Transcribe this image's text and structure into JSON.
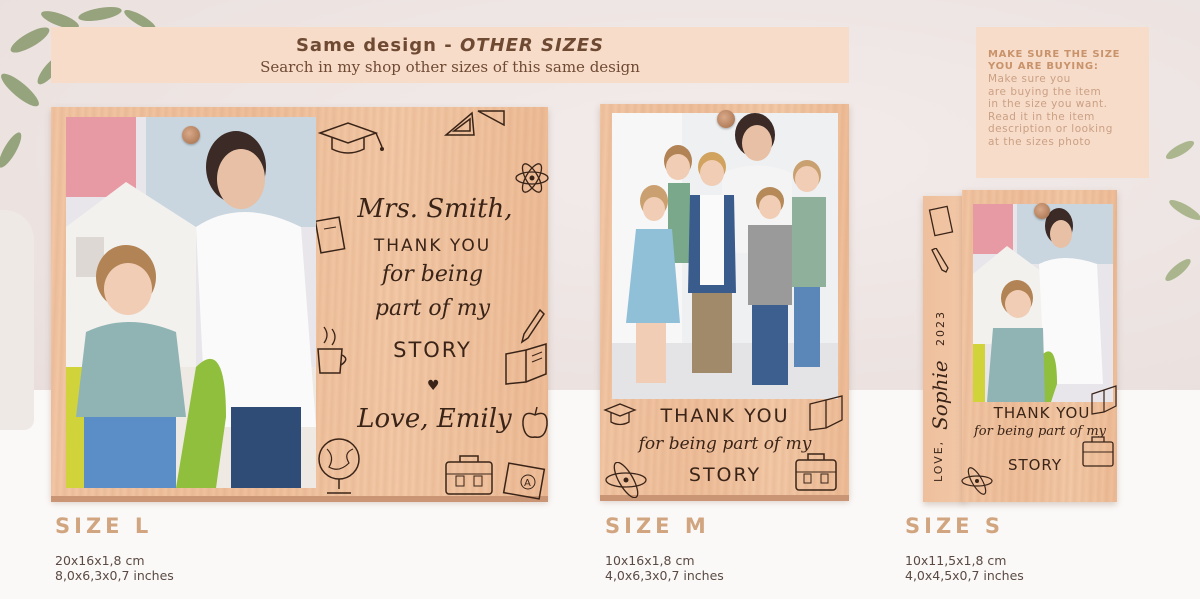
{
  "banner": {
    "title_prefix": "Same design - ",
    "title_emphasis": "OTHER SIZES",
    "subtitle": "Search in my shop other sizes of this same design"
  },
  "note": {
    "heading_line1": "MAKE SURE THE SIZE",
    "heading_line2": "YOU ARE BUYING:",
    "body_lines": [
      "Make sure you",
      "are buying the item",
      "in the size you want.",
      "Read it in the item",
      "description or looking",
      "at the sizes photo"
    ]
  },
  "frame_l": {
    "name_line": "Mrs. Smith,",
    "line_thank": "THANK YOU",
    "line_being": "for being",
    "line_part": "part of my",
    "line_story": "STORY",
    "signoff": "Love, Emily"
  },
  "frame_m": {
    "line_thank": "THANK YOU",
    "line_being": "for being part of my",
    "line_story": "STORY"
  },
  "frame_s": {
    "line_thank": "THANK YOU",
    "line_being": "for being part of my",
    "line_story": "STORY",
    "side_love": "LOVE,",
    "side_name": "Sophie",
    "side_year": "2023"
  },
  "sizes": [
    {
      "title": "SIZE L",
      "cm": "20x16x1,8 cm",
      "inches": "8,0x6,3x0,7 inches"
    },
    {
      "title": "SIZE M",
      "cm": "10x16x1,8 cm",
      "inches": "4,0x6,3x0,7 inches"
    },
    {
      "title": "SIZE S",
      "cm": "10x11,5x1,8 cm",
      "inches": "4,0x4,5x0,7 inches"
    }
  ],
  "colors": {
    "banner_bg": "#f8dcca",
    "banner_text": "#6f4a33",
    "size_title": "#d0a57f",
    "wood": "#f2c6a4",
    "engraving": "#3a2418"
  },
  "icons": [
    "graduation-cap-icon",
    "set-square-icon",
    "atom-icon",
    "notebook-icon",
    "pencil-icon",
    "coffee-cup-icon",
    "open-book-icon",
    "heart-icon",
    "apple-icon",
    "globe-icon",
    "satchel-icon",
    "grade-paper-icon"
  ]
}
